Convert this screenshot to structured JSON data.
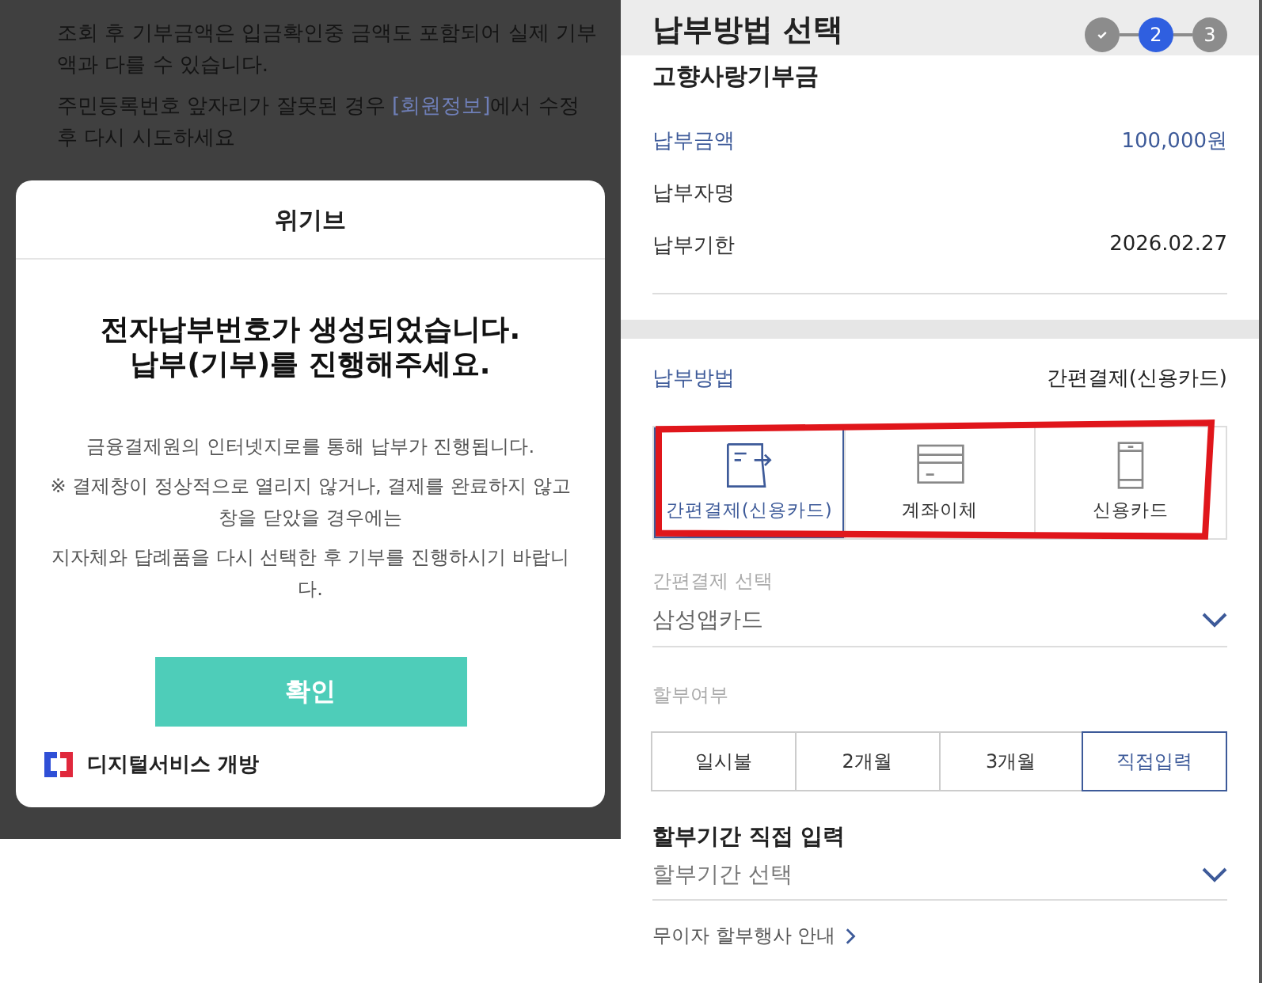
{
  "left_screen": {
    "notices": [
      {
        "parts": [
          {
            "text": "조회 후 기부금액은 입금확인중 금액도 포함되어 실제 기부액과 다를 수 있습니다."
          }
        ]
      },
      {
        "parts": [
          {
            "text": "주민등록번호 앞자리가 잘못된 경우 "
          },
          {
            "text": "[회원정보]",
            "kind": "link"
          },
          {
            "text": "에서 수정 후 다시 시도하세요"
          }
        ]
      }
    ],
    "dialog": {
      "title": "위기브",
      "heading": [
        "전자납부번호가 생성되었습니다.",
        "납부(기부)를 진행해주세요."
      ],
      "messages": [
        "금융결제원의 인터넷지로를 통해 납부가 진행됩니다.",
        "※ 결제창이 정상적으로 열리지 않거나, 결제를 완료하지 않고 창을 닫았을 경우에는",
        "지자체와 답례품을 다시 선택한 후 기부를 진행하시기 바랍니다."
      ],
      "confirm_button": "확인",
      "footer_brand": "디지털서비스 개방"
    }
  },
  "right_screen": {
    "title": "납부방법 선택",
    "steps": [
      {
        "kind": "done"
      },
      {
        "kind": "current",
        "label": "2"
      },
      {
        "kind": "todo",
        "label": "3"
      }
    ],
    "summary": {
      "title": "고향사랑기부금",
      "rows": [
        {
          "label": "납부금액",
          "value": "100,000원",
          "kind": "highlight"
        },
        {
          "label": "납부자명",
          "kind": "hidden"
        },
        {
          "label": "납부기한",
          "value": "2026.02.27",
          "kind": "plain"
        }
      ]
    },
    "payment": {
      "label": "납부방법",
      "value": "간편결제(신용카드)",
      "methods": [
        {
          "label": "간편결제(신용카드)",
          "kind": "easy",
          "selected": true
        },
        {
          "label": "계좌이체",
          "kind": "transfer",
          "selected": false
        },
        {
          "label": "신용카드",
          "kind": "card",
          "selected": false
        }
      ],
      "easy_pay": {
        "label": "간편결제 선택",
        "value": "삼성앱카드"
      },
      "installment": {
        "label": "할부여부",
        "options": [
          {
            "label": "일시불",
            "selected": false
          },
          {
            "label": "2개월",
            "selected": false
          },
          {
            "label": "3개월",
            "selected": false
          },
          {
            "label": "직접입력",
            "selected": true
          }
        ]
      },
      "custom_installment": {
        "title": "할부기간 직접 입력",
        "placeholder": "할부기간 선택"
      },
      "info_link": "무이자 할부행사 안내"
    }
  }
}
